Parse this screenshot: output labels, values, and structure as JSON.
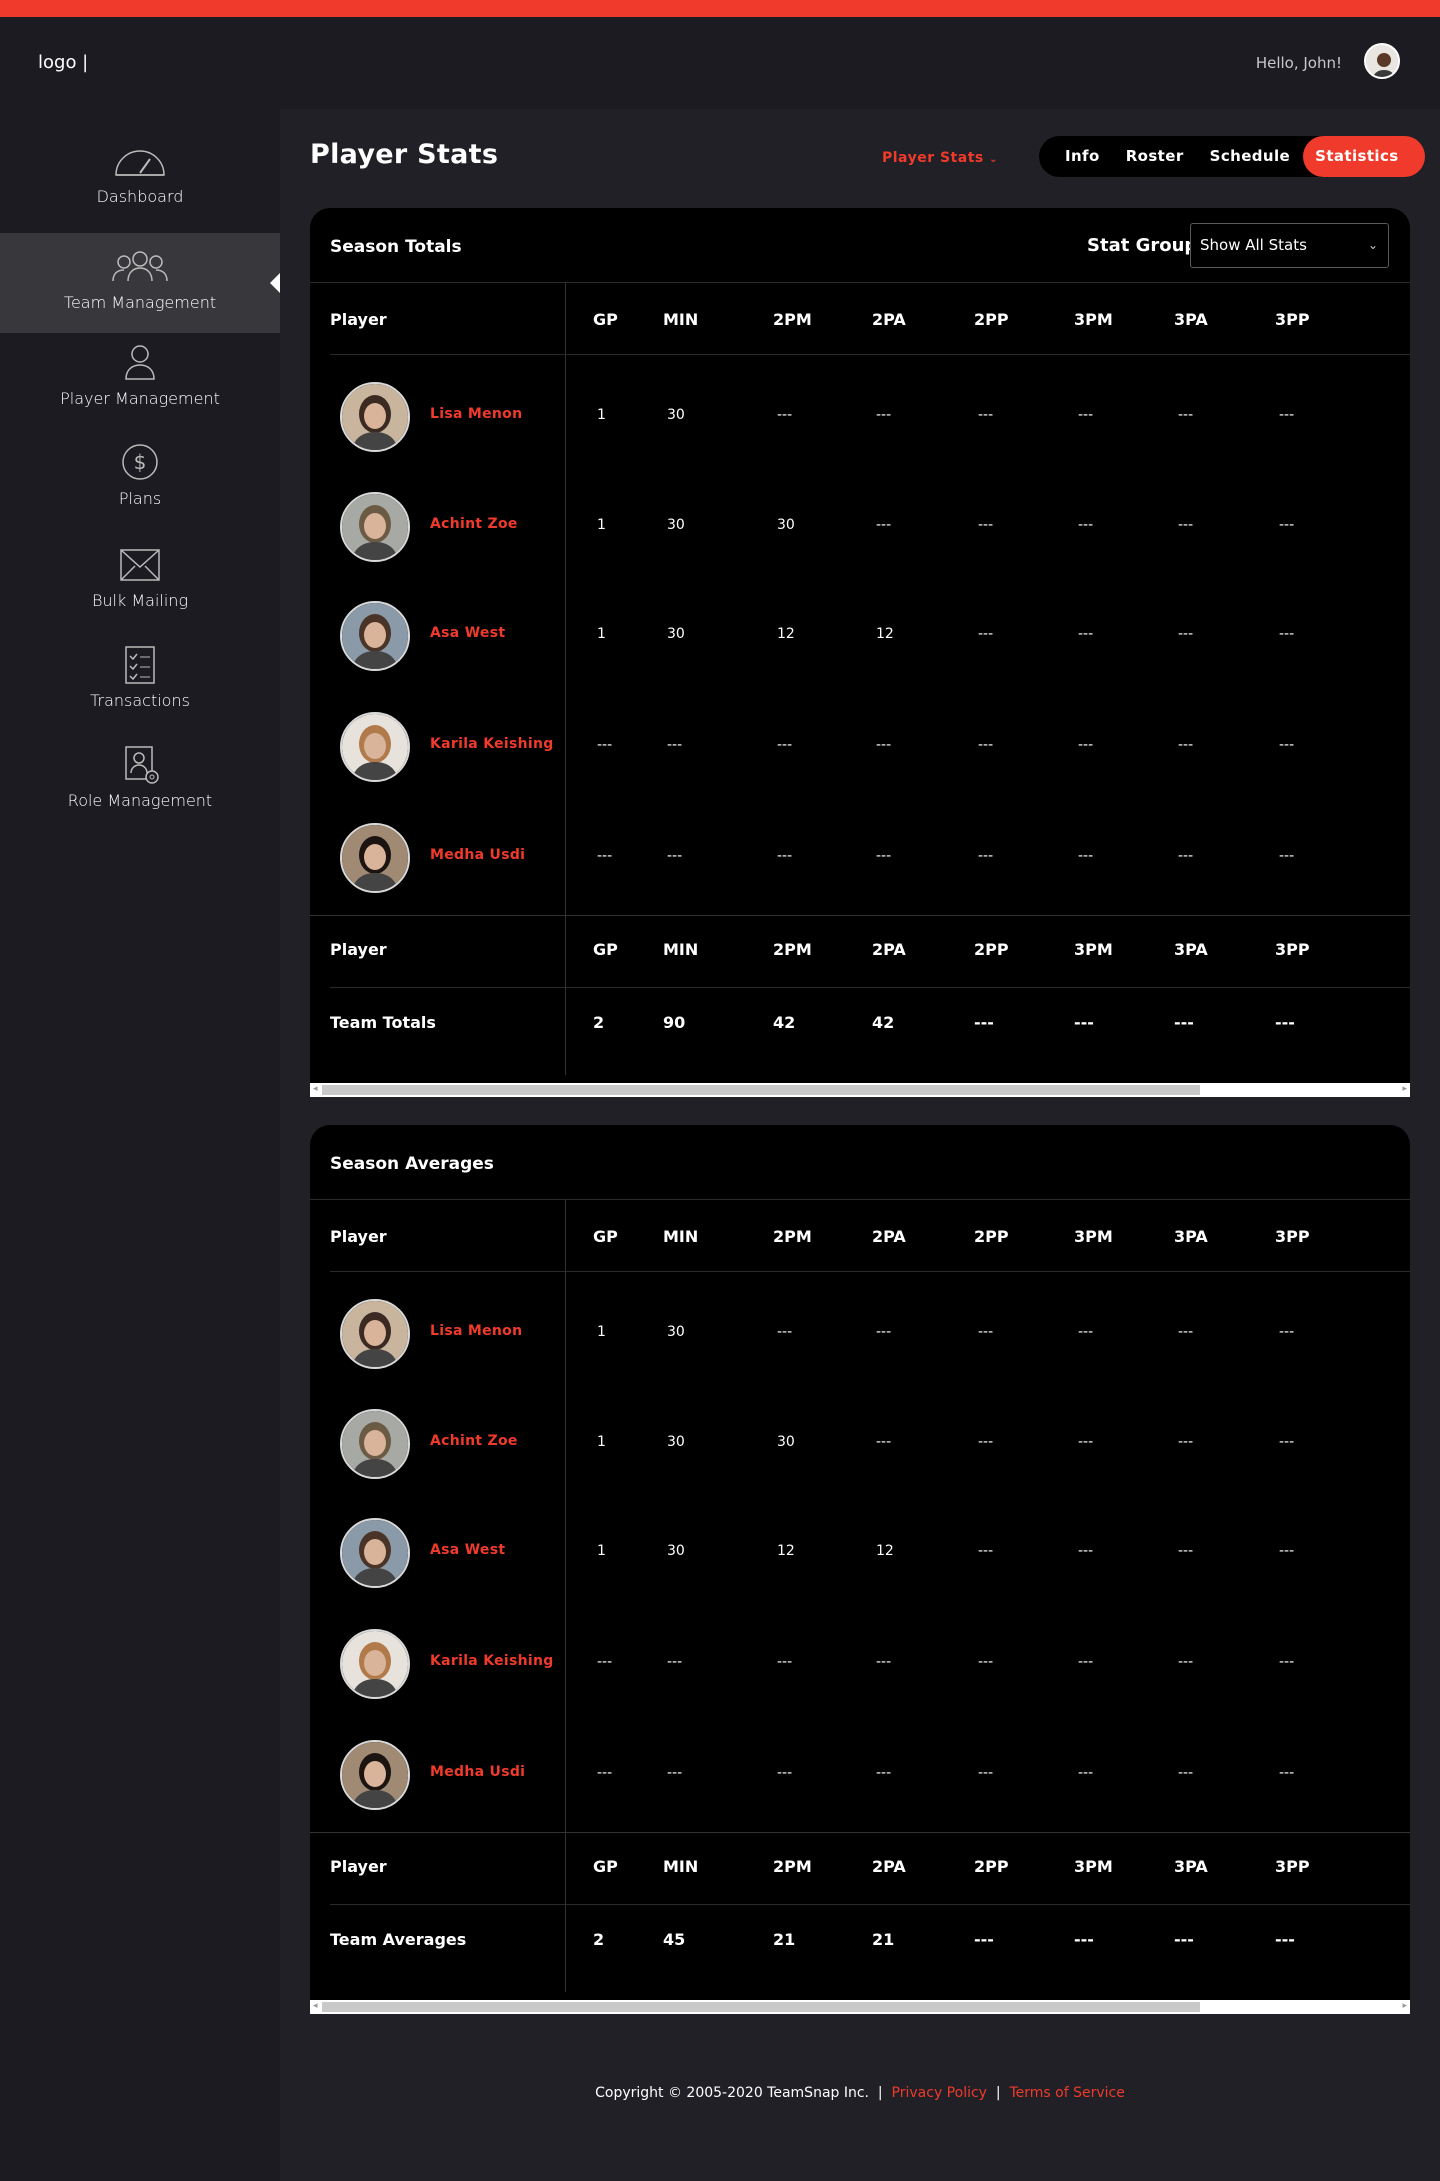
{
  "header": {
    "logo": "logo |",
    "greeting": "Hello, John!"
  },
  "sidebar": {
    "items": [
      {
        "label": "Dashboard",
        "icon": "speedometer-icon"
      },
      {
        "label": "Team Management",
        "icon": "team-icon"
      },
      {
        "label": "Player Management",
        "icon": "person-icon"
      },
      {
        "label": "Plans",
        "icon": "dollar-icon"
      },
      {
        "label": "Bulk Mailing",
        "icon": "envelope-icon"
      },
      {
        "label": "Transactions",
        "icon": "checklist-icon"
      },
      {
        "label": "Role Management",
        "icon": "user-gear-icon"
      }
    ],
    "active": "Team Management"
  },
  "page": {
    "title": "Player Stats",
    "dropdown": "Player Stats",
    "tabs": [
      "Info",
      "Roster",
      "Schedule",
      "Statistics"
    ],
    "active_tab": "Statistics"
  },
  "stat_group": {
    "label": "Stat Group",
    "value": "Show All Stats"
  },
  "columns": [
    "Player",
    "GP",
    "MIN",
    "2PM",
    "2PA",
    "2PP",
    "3PM",
    "3PA",
    "3PP"
  ],
  "season_totals": {
    "title": "Season Totals",
    "rows": [
      {
        "name": "Lisa Menon",
        "values": [
          "1",
          "30",
          "---",
          "---",
          "---",
          "---",
          "---",
          "---"
        ]
      },
      {
        "name": "Achint Zoe",
        "values": [
          "1",
          "30",
          "30",
          "---",
          "---",
          "---",
          "---",
          "---"
        ]
      },
      {
        "name": "Asa West",
        "values": [
          "1",
          "30",
          "12",
          "12",
          "---",
          "---",
          "---",
          "---"
        ]
      },
      {
        "name": "Karila Keishing",
        "values": [
          "---",
          "---",
          "---",
          "---",
          "---",
          "---",
          "---",
          "---"
        ]
      },
      {
        "name": "Medha Usdi",
        "values": [
          "---",
          "---",
          "---",
          "---",
          "---",
          "---",
          "---",
          "---"
        ]
      }
    ],
    "total_label": "Team Totals",
    "totals": [
      "2",
      "90",
      "42",
      "42",
      "---",
      "---",
      "---",
      "---"
    ]
  },
  "season_averages": {
    "title": "Season Averages",
    "rows": [
      {
        "name": "Lisa Menon",
        "values": [
          "1",
          "30",
          "---",
          "---",
          "---",
          "---",
          "---",
          "---"
        ]
      },
      {
        "name": "Achint Zoe",
        "values": [
          "1",
          "30",
          "30",
          "---",
          "---",
          "---",
          "---",
          "---"
        ]
      },
      {
        "name": "Asa West",
        "values": [
          "1",
          "30",
          "12",
          "12",
          "---",
          "---",
          "---",
          "---"
        ]
      },
      {
        "name": "Karila Keishing",
        "values": [
          "---",
          "---",
          "---",
          "---",
          "---",
          "---",
          "---",
          "---"
        ]
      },
      {
        "name": "Medha Usdi",
        "values": [
          "---",
          "---",
          "---",
          "---",
          "---",
          "---",
          "---",
          "---"
        ]
      }
    ],
    "total_label": "Team Averages",
    "totals": [
      "2",
      "45",
      "21",
      "21",
      "---",
      "---",
      "---",
      "---"
    ]
  },
  "footer": {
    "copyright": "Copyright © 2005-2020 TeamSnap Inc.",
    "sep": "|",
    "privacy": "Privacy Policy",
    "terms": "Terms of Service"
  },
  "colors": {
    "accent": "#f03a2b",
    "background": "#1b1b21",
    "panel": "#000000"
  }
}
